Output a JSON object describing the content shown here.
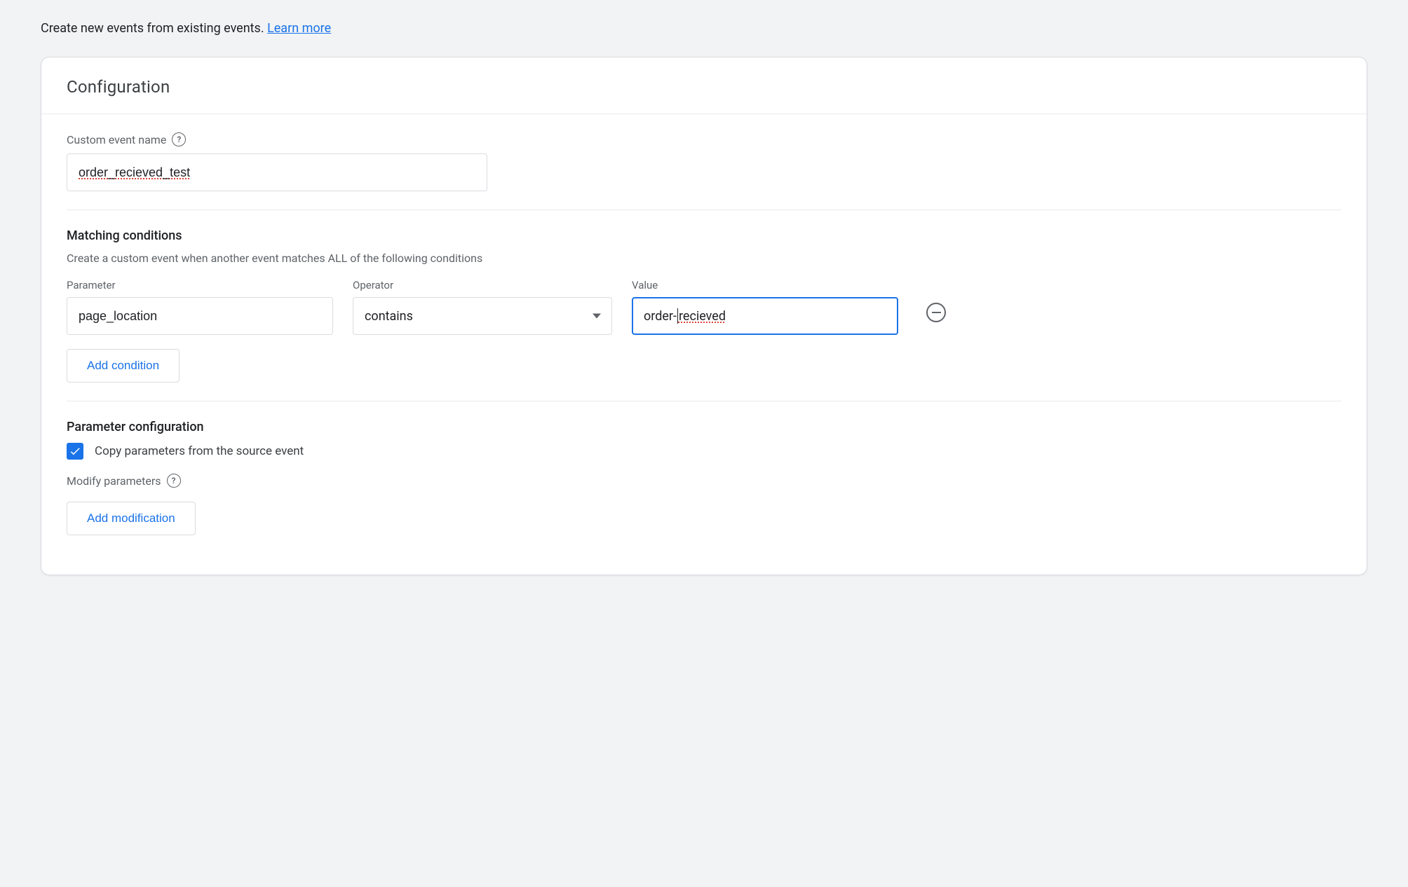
{
  "intro": {
    "text": "Create new events from existing events. ",
    "link_label": "Learn more"
  },
  "card": {
    "title": "Configuration"
  },
  "custom_event": {
    "label": "Custom event name",
    "value": "order_recieved_test"
  },
  "matching": {
    "heading": "Matching conditions",
    "subtext": "Create a custom event when another event matches ALL of the following conditions",
    "cols": {
      "parameter": "Parameter",
      "operator": "Operator",
      "value": "Value"
    },
    "rows": [
      {
        "parameter": "page_location",
        "operator": "contains",
        "value_prefix": "order-",
        "value_suffix": "recieved"
      }
    ],
    "add_condition_label": "Add condition"
  },
  "param_config": {
    "heading": "Parameter configuration",
    "copy_checked": true,
    "copy_label": "Copy parameters from the source event",
    "modify_label": "Modify parameters",
    "add_modification_label": "Add modification"
  }
}
